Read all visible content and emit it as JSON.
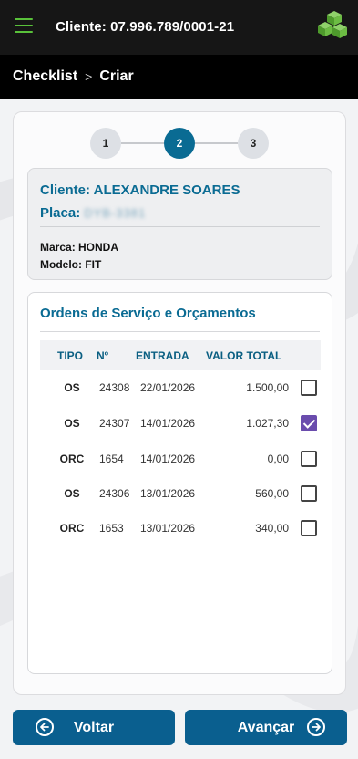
{
  "header": {
    "client_label": "Cliente: 07.996.789/0001-21"
  },
  "breadcrumb": {
    "items": [
      "Checklist",
      "Criar"
    ],
    "separator": ">"
  },
  "stepper": {
    "steps": [
      "1",
      "2",
      "3"
    ],
    "active_index": 1
  },
  "client_card": {
    "name_label": "Cliente: ALEXANDRE SOARES",
    "placa_label": "Placa:",
    "placa_value": "DYB-3381",
    "marca": "Marca: HONDA",
    "modelo": "Modelo: FIT"
  },
  "orders": {
    "title": "Ordens de Serviço e Orçamentos",
    "columns": [
      "TIPO",
      "Nº",
      "ENTRADA",
      "VALOR TOTAL"
    ],
    "rows": [
      {
        "tipo": "OS",
        "num": "24308",
        "entrada": "22/01/2026",
        "valor": "1.500,00",
        "checked": false
      },
      {
        "tipo": "OS",
        "num": "24307",
        "entrada": "14/01/2026",
        "valor": "1.027,30",
        "checked": true
      },
      {
        "tipo": "ORC",
        "num": "1654",
        "entrada": "14/01/2026",
        "valor": "0,00",
        "checked": false
      },
      {
        "tipo": "OS",
        "num": "24306",
        "entrada": "13/01/2026",
        "valor": "560,00",
        "checked": false
      },
      {
        "tipo": "ORC",
        "num": "1653",
        "entrada": "13/01/2026",
        "valor": "340,00",
        "checked": false
      }
    ]
  },
  "footer": {
    "back_label": "Voltar",
    "next_label": "Avançar"
  },
  "colors": {
    "primary": "#0a6b93",
    "button": "#0a5f8f",
    "checkbox_checked": "#6a4cad",
    "menu_icon": "#59c13a"
  },
  "icons": {
    "menu": "hamburger-icon",
    "logo": "cubes-logo",
    "back": "arrow-left-circle-icon",
    "next": "arrow-right-circle-icon"
  }
}
